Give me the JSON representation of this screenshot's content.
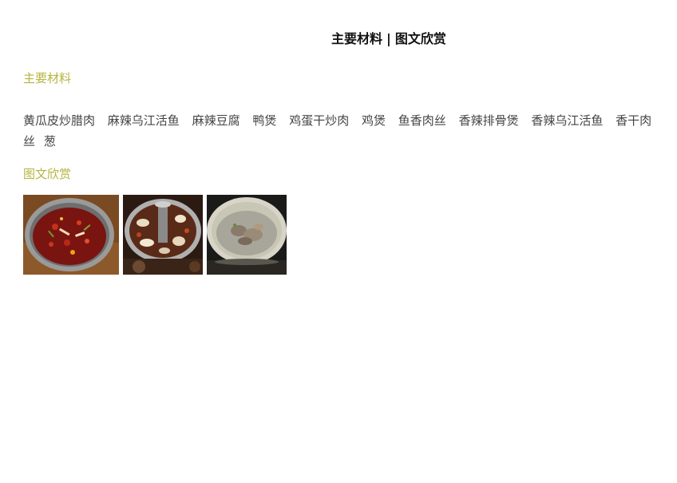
{
  "header": {
    "link_materials": "主要材料",
    "separator": "|",
    "link_gallery": "图文欣赏"
  },
  "materials": {
    "title": "主要材料",
    "items": [
      "黄瓜皮炒腊肉",
      "麻辣乌江活鱼",
      "麻辣豆腐",
      "鸭煲",
      "鸡蛋干炒肉",
      "鸡煲",
      "鱼香肉丝",
      "香辣排骨煲",
      "香辣乌江活鱼",
      "香干肉丝",
      "葱"
    ]
  },
  "gallery": {
    "title": "图文欣赏",
    "images": [
      {
        "name": "spicy-fish-hotpot-image"
      },
      {
        "name": "mushroom-hotpot-image"
      },
      {
        "name": "chicken-soup-image"
      }
    ]
  },
  "colors": {
    "section_title": "#b5b540",
    "text": "#444444",
    "header": "#111111"
  }
}
